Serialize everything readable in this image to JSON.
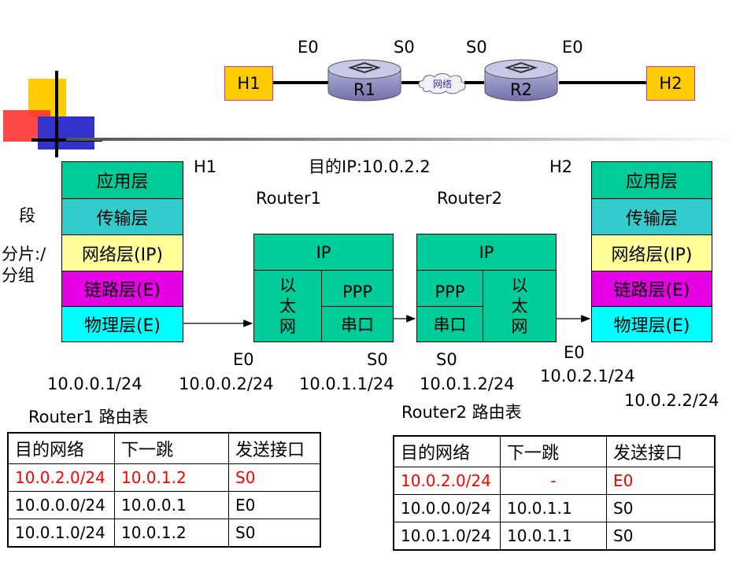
{
  "topology": {
    "labels": {
      "h1_e0": "E0",
      "r1_s0": "S0",
      "r2_s0": "S0",
      "r2_e0": "E0"
    },
    "h1": "H1",
    "r1": "R1",
    "cloud": "网络",
    "r2": "R2",
    "h2": "H2"
  },
  "hosts": {
    "h1": "H1",
    "h2": "H2",
    "dest_ip": "目的IP:10.0.2.2"
  },
  "left_text": {
    "duan": "段",
    "fenpian": "分片:/",
    "fenzu": "分组"
  },
  "stack_left": [
    "应用层",
    "传输层",
    "网络层(IP)",
    "链路层(E)",
    "物理层(E)"
  ],
  "stack_right": [
    "应用层",
    "传输层",
    "网络层(IP)",
    "链路层(E)",
    "物理层(E)"
  ],
  "router1": {
    "title": "Router1",
    "ip": "IP",
    "eth": [
      "以",
      "太",
      "网"
    ],
    "ppp": "PPP",
    "serial": "串口"
  },
  "router2": {
    "title": "Router2",
    "ip": "IP",
    "eth": [
      "以",
      "太",
      "网"
    ],
    "ppp": "PPP",
    "serial": "串口"
  },
  "ports": {
    "r1_e0": "E0",
    "r1_s0": "S0",
    "r2_s0": "S0",
    "r2_e0": "E0"
  },
  "addresses": {
    "h1": "10.0.0.1/24",
    "r1_e0": "10.0.0.2/24",
    "r1_s0": "10.0.1.1/24",
    "r2_s0": "10.0.1.2/24",
    "r2_e0": "10.0.2.1/24",
    "h2": "10.0.2.2/24"
  },
  "table1": {
    "title": "Router1 路由表",
    "headers": [
      "目的网络",
      "下一跳",
      "发送接口"
    ],
    "rows": [
      [
        "10.0.2.0/24",
        "10.0.1.2",
        "S0"
      ],
      [
        "10.0.0.0/24",
        "10.0.0.1",
        "E0"
      ],
      [
        "10.0.1.0/24",
        "10.0.1.2",
        "S0"
      ]
    ]
  },
  "table2": {
    "title": "Router2 路由表",
    "headers": [
      "目的网络",
      "下一跳",
      "发送接口"
    ],
    "rows": [
      [
        "10.0.2.0/24",
        "-",
        "E0"
      ],
      [
        "10.0.0.0/24",
        "10.0.1.1",
        "S0"
      ],
      [
        "10.0.1.0/24",
        "10.0.1.1",
        "S0"
      ]
    ]
  },
  "colors": {
    "highlight": "#ff0000",
    "host": "#ffcc00",
    "teal": "#00cc99",
    "magenta": "#e600e6",
    "cyan": "#00ffff",
    "yellow": "#ffff99"
  }
}
